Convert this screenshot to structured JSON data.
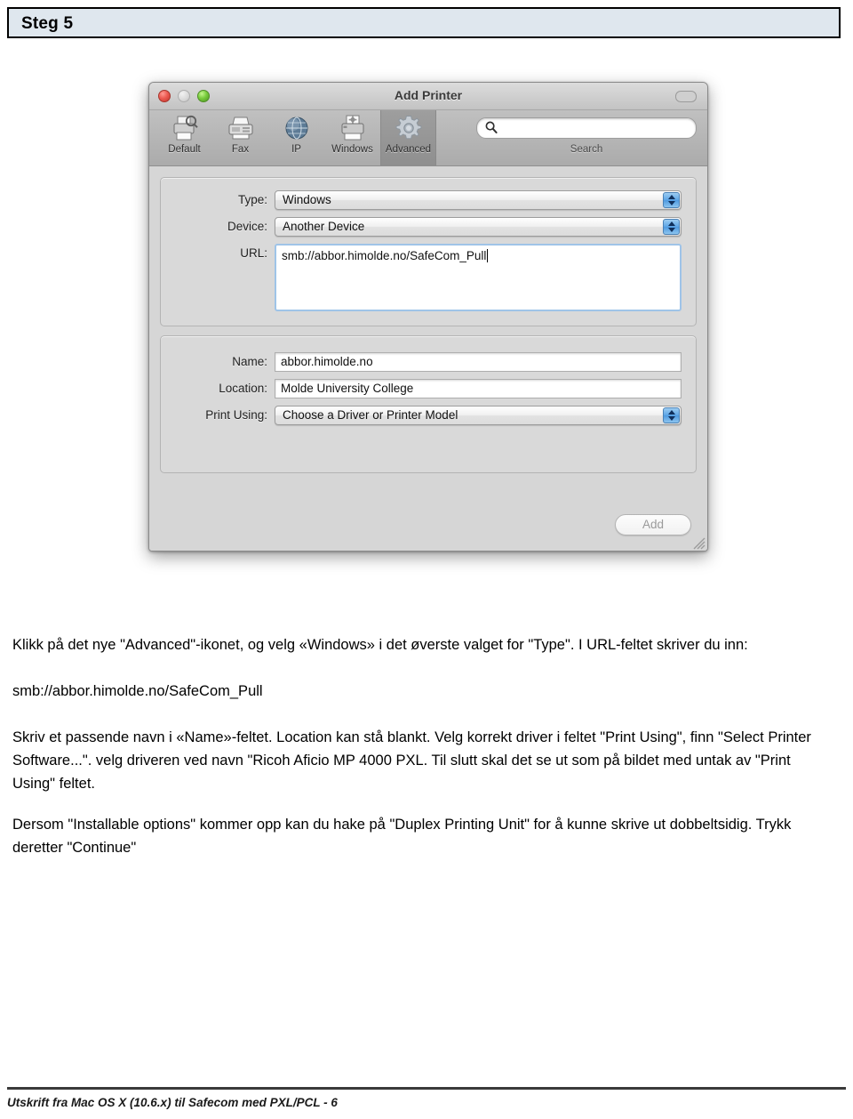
{
  "header": {
    "step_label": "Steg 5",
    "background_color": "#dfe7ee"
  },
  "dialog": {
    "title": "Add Printer",
    "traffic_lights": {
      "close": "close-button",
      "minimize": "minimize-button",
      "zoom": "zoom-button"
    },
    "toolbar": {
      "items": [
        {
          "label": "Default",
          "icon": "printer-magnifier-icon",
          "selected": false
        },
        {
          "label": "Fax",
          "icon": "fax-machine-icon",
          "selected": false
        },
        {
          "label": "IP",
          "icon": "globe-icon",
          "selected": false
        },
        {
          "label": "Windows",
          "icon": "network-printer-icon",
          "selected": false
        },
        {
          "label": "Advanced",
          "icon": "gear-icon",
          "selected": true
        }
      ],
      "search": {
        "value": "",
        "placeholder": "",
        "caption": "Search",
        "icon": "search-icon"
      }
    },
    "connection_group": {
      "type": {
        "label": "Type:",
        "value": "Windows"
      },
      "device": {
        "label": "Device:",
        "value": "Another Device"
      },
      "url": {
        "label": "URL:",
        "value": "smb://abbor.himolde.no/SafeCom_Pull",
        "focused": true
      }
    },
    "identity_group": {
      "name": {
        "label": "Name:",
        "value": "abbor.himolde.no"
      },
      "location": {
        "label": "Location:",
        "value": "Molde University College"
      },
      "print_using": {
        "label": "Print Using:",
        "value": "Choose a Driver or Printer Model"
      }
    },
    "add_button": {
      "label": "Add",
      "enabled": false
    }
  },
  "content": {
    "paragraph_1": "Klikk på det nye \"Advanced\"-ikonet, og velg «Windows» i det øverste valget for \"Type\". I URL-feltet skriver du inn:",
    "url_line": "smb://abbor.himolde.no/SafeCom_Pull",
    "paragraph_2": "Skriv et passende navn i «Name»-feltet. Location kan stå blankt. Velg korrekt driver i feltet \"Print Using\", finn \"Select Printer Software...\". velg driveren ved navn \"Ricoh Aficio MP 4000 PXL. Til slutt skal det se ut som på bildet med untak av \"Print Using\" feltet.",
    "paragraph_3": "Dersom \"Installable options\" kommer opp kan du hake på \"Duplex Printing Unit\" for å kunne skrive ut dobbeltsidig. Trykk deretter \"Continue\""
  },
  "footer": {
    "text": "Utskrift fra Mac OS X (10.6.x) til Safecom med PXL/PCL - 6"
  }
}
